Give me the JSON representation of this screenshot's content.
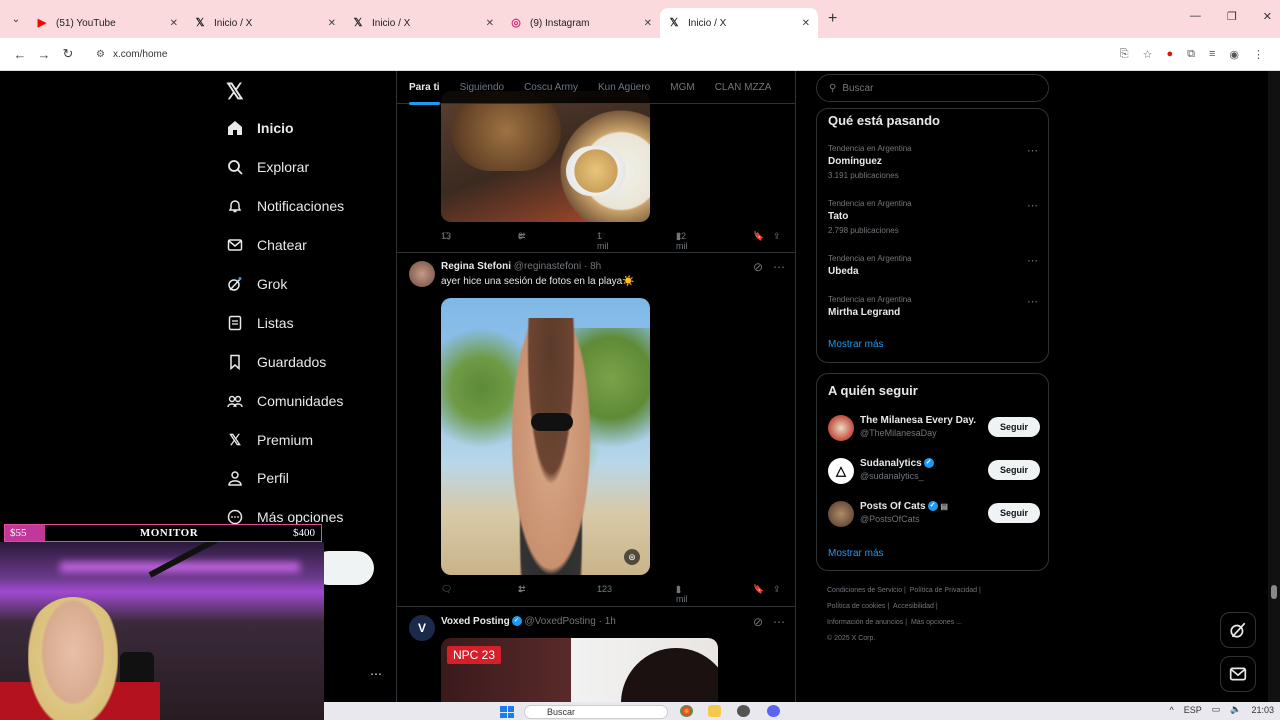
{
  "browser": {
    "tabs": [
      {
        "title": "(51) YouTube",
        "icon": "youtube-icon",
        "active": false
      },
      {
        "title": "Inicio / X",
        "icon": "x-logo-icon",
        "active": false
      },
      {
        "title": "Inicio / X",
        "icon": "x-logo-icon",
        "active": false
      },
      {
        "title": "(9) Instagram",
        "icon": "instagram-icon",
        "active": false
      },
      {
        "title": "Inicio / X",
        "icon": "x-logo-icon",
        "active": true
      }
    ],
    "url": "x.com/home"
  },
  "nav": {
    "items": [
      {
        "label": "Inicio",
        "icon": "home-icon"
      },
      {
        "label": "Explorar",
        "icon": "search-icon"
      },
      {
        "label": "Notificaciones",
        "icon": "bell-icon"
      },
      {
        "label": "Chatear",
        "icon": "mail-icon"
      },
      {
        "label": "Grok",
        "icon": "grok-icon"
      },
      {
        "label": "Listas",
        "icon": "list-icon"
      },
      {
        "label": "Guardados",
        "icon": "bookmark-icon"
      },
      {
        "label": "Comunidades",
        "icon": "communities-icon"
      },
      {
        "label": "Premium",
        "icon": "x-logo-icon"
      },
      {
        "label": "Perfil",
        "icon": "person-icon"
      },
      {
        "label": "Más opciones",
        "icon": "more-circle-icon"
      }
    ]
  },
  "feed": {
    "tabs": [
      "Para ti",
      "Siguiendo",
      "Coscu Army",
      "Kun Agüero",
      "MGM",
      "CLAN MZZA"
    ],
    "post1": {
      "replies": "13",
      "reposts": "6",
      "likes": "1 mil",
      "views": "22 mil"
    },
    "post2": {
      "name": "Regina Stefoni",
      "handle": "@reginastefoni · 8h",
      "text": "ayer hice una sesión de fotos en la playa☀️",
      "replies": "",
      "reposts": "1",
      "likes": "123",
      "views": "1 mil"
    },
    "post3": {
      "name": "Voxed Posting",
      "handle": "@VoxedPosting · 1h",
      "image_tag": "NPC   23"
    }
  },
  "right": {
    "search_placeholder": "Buscar",
    "trends_title": "Qué está pasando",
    "trends": [
      {
        "context": "Tendencia en Argentina",
        "name": "Domínguez",
        "count": "3.191 publicaciones"
      },
      {
        "context": "Tendencia en Argentina",
        "name": "Tato",
        "count": "2.798 publicaciones"
      },
      {
        "context": "Tendencia en Argentina",
        "name": "Ubeda",
        "count": ""
      },
      {
        "context": "Tendencia en Argentina",
        "name": "Mirtha Legrand",
        "count": ""
      }
    ],
    "show_more": "Mostrar más",
    "follow_title": "A quién seguir",
    "follow": [
      {
        "name": "The Milanesa Every Day.",
        "handle": "@TheMilanesaDay",
        "button": "Seguir"
      },
      {
        "name": "Sudanalytics",
        "handle": "@sudanalytics_",
        "button": "Seguir"
      },
      {
        "name": "Posts Of Cats",
        "handle": "@PostsOfCats",
        "button": "Seguir"
      }
    ],
    "footer": [
      "Condiciones de Servicio",
      "Política de Privacidad",
      "Política de cookies",
      "Accesibilidad",
      "Información de anuncios",
      "Más opciones ...",
      "© 2025 X Corp."
    ]
  },
  "overlay": {
    "low": "$55",
    "label": "MONITOR",
    "high": "$400"
  },
  "taskbar": {
    "search": "Buscar",
    "lang": "ESP",
    "time": "21:03"
  }
}
